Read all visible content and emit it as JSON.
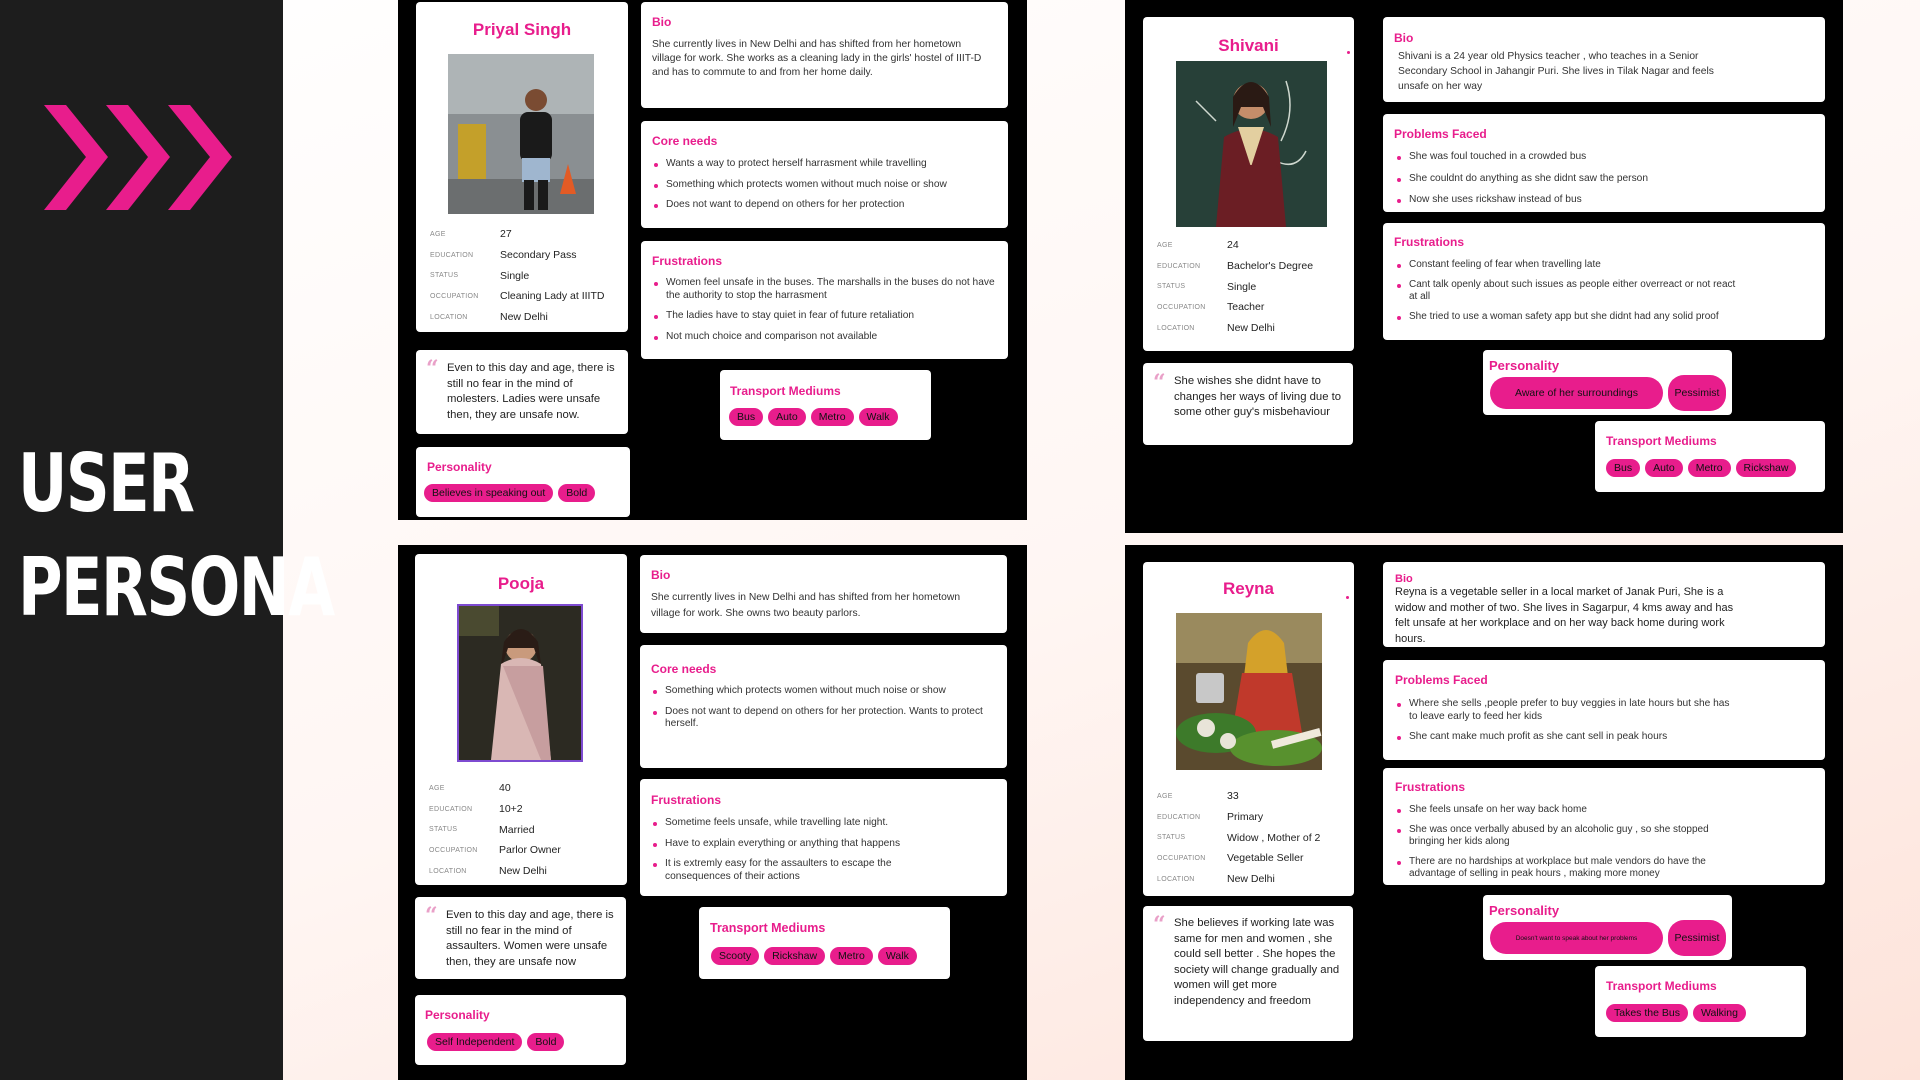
{
  "page": {
    "title_line1": "USER",
    "title_line2": "PERSONA"
  },
  "colors": {
    "accent": "#e81d8c",
    "sidebar": "#1d1d1d"
  },
  "labels": {
    "age": "AGE",
    "education": "EDUCATION",
    "status": "STATUS",
    "occupation": "OCCUPATION",
    "location": "LOCATION",
    "bio": "Bio",
    "core_needs": "Core needs",
    "frustrations": "Frustrations",
    "problems_faced": "Problems Faced",
    "personality": "Personality",
    "transport": "Transport Mediums"
  },
  "personas": [
    {
      "name": "Priyal Singh",
      "photo_icon": "woman-cleaner-photo",
      "age": "27",
      "education": "Secondary Pass",
      "status": "Single",
      "occupation": "Cleaning Lady at IIITD",
      "location": "New Delhi",
      "bio": "She currently lives in New Delhi and has shifted from her hometown village for work. She works as a cleaning lady in the girls' hostel of IIIT-D and has to commute to and from her home daily.",
      "section2_items": [
        "Wants a way to protect herself harrasment while travelling",
        "Something which protects women without much noise or show",
        "Does not want to depend on others for her protection"
      ],
      "frustrations": [
        "Women feel unsafe in the buses. The marshalls in the buses do not have the authority to stop the harrasment",
        "The ladies have to stay quiet in fear of future retaliation",
        "Not much choice and comparison not available"
      ],
      "quote": "Even to this day and age, there is still no fear in the mind of molesters. Ladies were unsafe then, they are unsafe now.",
      "personality": [
        "Believes in speaking out",
        "Bold"
      ],
      "transport": [
        "Bus",
        "Auto",
        "Metro",
        "Walk"
      ]
    },
    {
      "name": "Shivani",
      "photo_icon": "teacher-photo",
      "age": "24",
      "education": "Bachelor's Degree",
      "status": "Single",
      "occupation": "Teacher",
      "location": "New Delhi",
      "bio": "Shivani is a 24 year old Physics teacher , who teaches in a Senior Secondary School in Jahangir Puri. She lives in Tilak Nagar and feels unsafe on her way",
      "section2_items": [
        "She was foul touched in a crowded bus",
        "She couldnt do anything as she didnt saw the person",
        "Now she uses rickshaw instead of bus"
      ],
      "frustrations": [
        "Constant feeling of fear when travelling late",
        "Cant talk openly about such issues as people either overreact or not react at all",
        "She tried to  use a woman safety app but she didnt had any solid proof"
      ],
      "quote": "She wishes she didnt have to changes her ways of living due to some other guy's misbehaviour",
      "personality": [
        "Aware  of her surroundings",
        "Pessimist"
      ],
      "transport": [
        "Bus",
        "Auto",
        "Metro",
        "Rickshaw"
      ]
    },
    {
      "name": "Pooja",
      "photo_icon": "woman-saree-photo",
      "age": "40",
      "education": "10+2",
      "status": "Married",
      "occupation": "Parlor Owner",
      "location": "New Delhi",
      "bio": "She currently lives in New Delhi and has shifted from her hometown village for work. She owns two beauty parlors.",
      "section2_items": [
        "Something which protects women without much noise or show",
        "Does not want to depend on others for her protection. Wants to protect herself."
      ],
      "frustrations": [
        "Sometime feels unsafe, while travelling late night.",
        "Have to explain everything or anything that happens",
        "It is extremly easy for the assaulters to escape the consequences of their actions"
      ],
      "quote": "Even to this day and age, there is still no fear in the mind of assaulters. Women were unsafe then, they are unsafe now",
      "personality": [
        "Self  Independent",
        "Bold"
      ],
      "transport": [
        "Scooty",
        "Rickshaw",
        "Metro",
        "Walk"
      ]
    },
    {
      "name": "Reyna",
      "photo_icon": "vegetable-seller-photo",
      "age": "33",
      "education": "Primary",
      "status": "Widow , Mother of 2",
      "occupation": "Vegetable Seller",
      "location": "New Delhi",
      "bio": "Reyna is a vegetable seller in a local market of Janak Puri, She is a widow and mother of two. She lives in Sagarpur, 4 kms away and has felt unsafe at her workplace and on her way back home during work hours.",
      "section2_items": [
        "Where she sells ,people  prefer to buy veggies in late hours but she has to leave early to feed her kids",
        "She cant make much profit as she cant sell in peak hours"
      ],
      "frustrations": [
        "She feels unsafe on her way back home",
        "She was once verbally abused by an alcoholic guy , so she  stopped bringing her kids along",
        "There are no  hardships at workplace but male vendors do have the advantage of  selling  in peak hours , making more money"
      ],
      "quote": "She believes if working late was same for men and women , she could sell better . She hopes the society will change gradually and women will get more independency and freedom",
      "personality": [
        "Doesn't want to speak about her problems",
        "Pessimist"
      ],
      "transport": [
        "Takes the Bus",
        "Walking"
      ]
    }
  ]
}
